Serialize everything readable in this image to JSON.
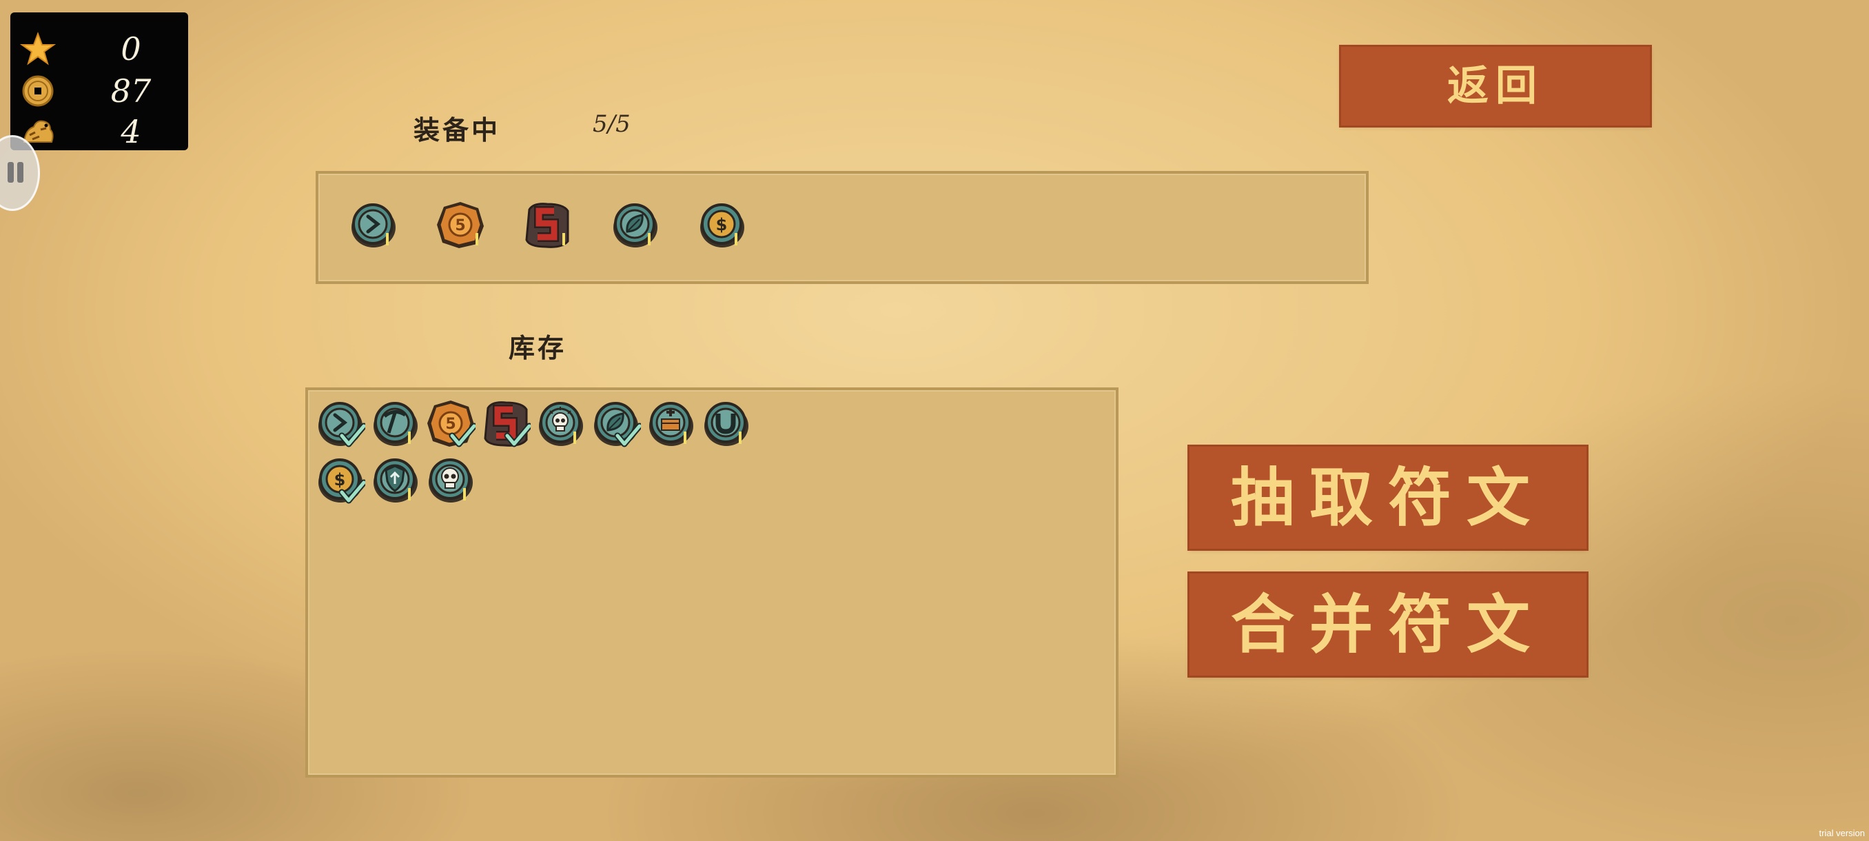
{
  "hud": {
    "stars": "0",
    "coins": "87",
    "tiger": "4",
    "icons": [
      "star-icon",
      "coin-icon",
      "tiger-icon"
    ]
  },
  "equipped": {
    "label": "装备中",
    "count": "5/5",
    "runes": [
      "dash-rune",
      "five-coin-rune",
      "s-rune",
      "leaf-rune",
      "dollar-rune"
    ]
  },
  "inventory": {
    "label": "库存",
    "runes": [
      {
        "icon": "dash-rune",
        "equipped": true
      },
      {
        "icon": "pickaxe-rune",
        "equipped": false
      },
      {
        "icon": "five-coin-rune",
        "equipped": true
      },
      {
        "icon": "s-rune",
        "equipped": true
      },
      {
        "icon": "skull-glow-rune",
        "equipped": false
      },
      {
        "icon": "leaf-rune",
        "equipped": true
      },
      {
        "icon": "chest-plus-rune",
        "equipped": false
      },
      {
        "icon": "magnet-rune",
        "equipped": false
      },
      {
        "icon": "dollar-rune",
        "equipped": true
      },
      {
        "icon": "shield-up-rune",
        "equipped": false
      },
      {
        "icon": "skull-rune",
        "equipped": false
      }
    ]
  },
  "buttons": {
    "back": "返回",
    "draw": "抽取符文",
    "merge": "合并符文"
  },
  "watermark": "trial version",
  "colors": {
    "button_bg": "#b5532a",
    "button_text": "#f7d784",
    "panel_bg": "#d9b878",
    "rune_teal": "#4f8a84",
    "rune_orange": "#d9822f",
    "rune_red": "#c2302a",
    "check_green": "#9fe0c6"
  }
}
